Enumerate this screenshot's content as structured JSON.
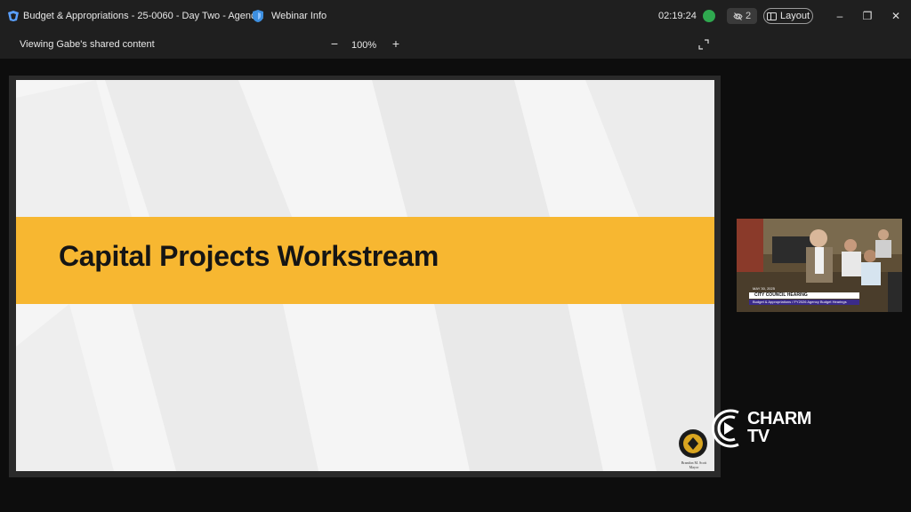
{
  "titlebar": {
    "title": "Budget & Appropriations - 25-0060 - Day Two - Agenc...",
    "webinar_info": "Webinar Info",
    "timer": "02:19:24",
    "participants_count": "2",
    "layout_label": "Layout",
    "minimize": "–",
    "restore": "❐",
    "close": "✕"
  },
  "subbar": {
    "viewing_text": "Viewing Gabe's shared content",
    "zoom_minus": "−",
    "zoom_level": "100%",
    "zoom_plus": "+"
  },
  "slide": {
    "title": "Capital Projects Workstream",
    "seal_caption_name": "Brandon M. Scott",
    "seal_caption_role": "Mayor"
  },
  "camera": {
    "date": "MAY 30, 2025",
    "hearing_title": "CITY COUNCIL HEARING",
    "hearing_subtitle": "Budget & Appropriations / FY2026 Agency Budget Hearings"
  },
  "watermark": {
    "line1": "CHARM",
    "line2": "TV"
  },
  "colors": {
    "banner": "#f7b731",
    "background": "#1f1f1f",
    "signal": "#2fa84f"
  }
}
